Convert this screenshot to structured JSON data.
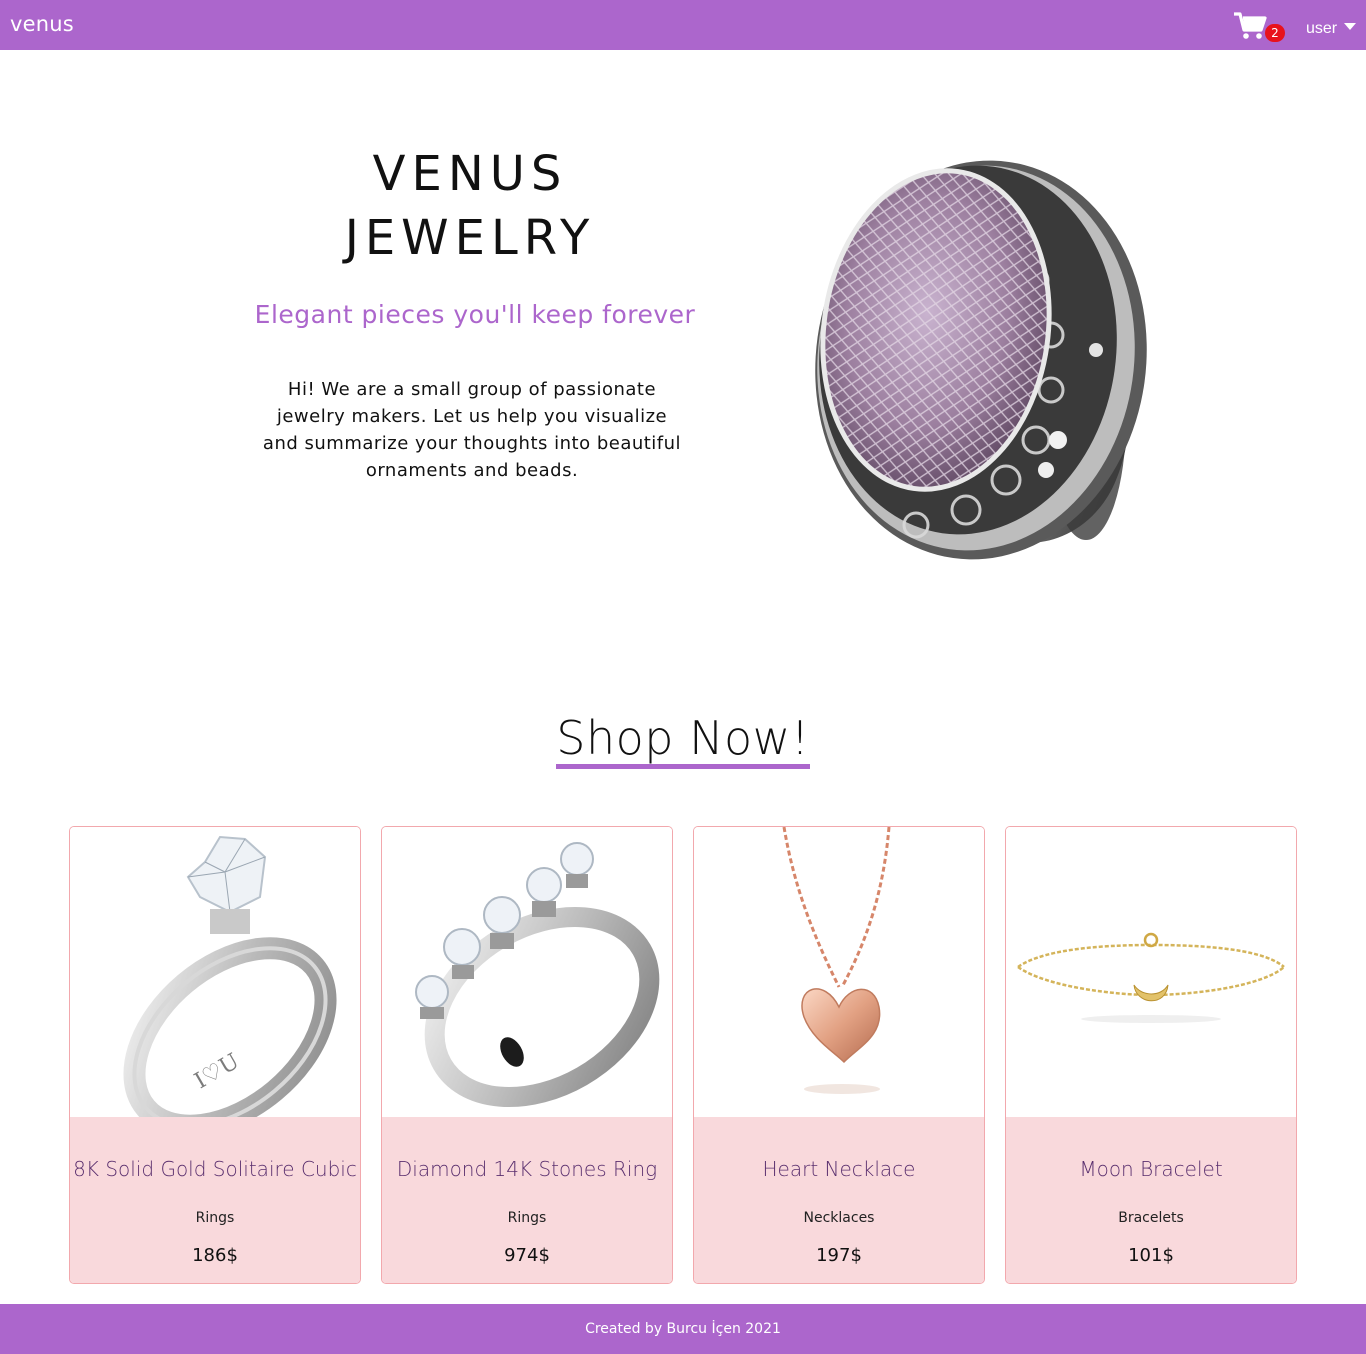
{
  "navbar": {
    "brand": "venus",
    "cart_count": "2",
    "user_label": "user",
    "icons": [
      "shopping-cart-icon",
      "caret-down-icon"
    ]
  },
  "hero": {
    "title_line1": "VENUS",
    "title_line2": "JEWELRY",
    "tagline": "Elegant pieces you'll keep forever",
    "intro": "Hi! We are a small group of passionate jewelry makers. Let us help you visualize and summarize your thoughts into beautiful ornaments and beads."
  },
  "shop": {
    "heading": "Shop Now!",
    "products": [
      {
        "name": "8K Solid Gold Solitaire Cubic",
        "category": "Rings",
        "price": "186$"
      },
      {
        "name": "Diamond 14K Stones Ring",
        "category": "Rings",
        "price": "974$"
      },
      {
        "name": "Heart Necklace",
        "category": "Necklaces",
        "price": "197$"
      },
      {
        "name": "Moon Bracelet",
        "category": "Bracelets",
        "price": "101$"
      }
    ]
  },
  "footer": {
    "text": "Created by Burcu İçen 2021"
  },
  "colors": {
    "accent": "#ac66cc",
    "card_info_bg": "#f9d9dc",
    "card_border": "#f2a8ad",
    "badge": "#e8121c"
  }
}
